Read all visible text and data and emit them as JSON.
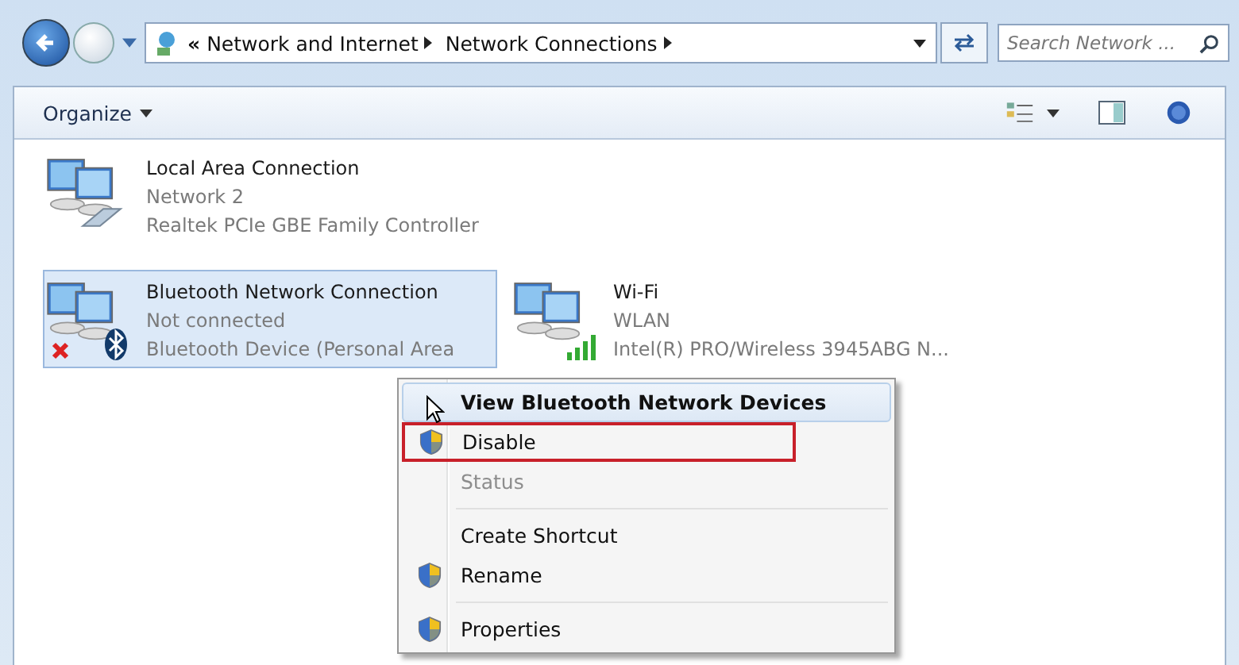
{
  "address_bar": {
    "overflow": "«",
    "breadcrumbs": [
      "Network and Internet",
      "Network Connections"
    ]
  },
  "search": {
    "placeholder": "Search Network ..."
  },
  "toolbar": {
    "organize": "Organize"
  },
  "connections": [
    {
      "name": "Local Area Connection",
      "status": "Network  2",
      "device": "Realtek PCIe GBE Family Controller",
      "kind": "wired",
      "selected": false
    },
    {
      "name": "Bluetooth Network Connection",
      "status": "Not connected",
      "device": "Bluetooth Device (Personal Area",
      "kind": "bluetooth",
      "selected": true
    },
    {
      "name": "Wi-Fi",
      "status": "WLAN",
      "device": "Intel(R) PRO/Wireless 3945ABG N...",
      "kind": "wifi",
      "selected": false
    }
  ],
  "context_menu": [
    {
      "label": "View Bluetooth Network Devices",
      "kind": "item",
      "default": true,
      "hovered": true,
      "shield": false,
      "disabled": false,
      "highlighted": false
    },
    {
      "label": "Disable",
      "kind": "item",
      "default": false,
      "hovered": false,
      "shield": true,
      "disabled": false,
      "highlighted": true
    },
    {
      "label": "Status",
      "kind": "item",
      "default": false,
      "hovered": false,
      "shield": false,
      "disabled": true,
      "highlighted": false
    },
    {
      "kind": "separator"
    },
    {
      "label": "Create Shortcut",
      "kind": "item",
      "default": false,
      "hovered": false,
      "shield": false,
      "disabled": false,
      "highlighted": false
    },
    {
      "label": "Rename",
      "kind": "item",
      "default": false,
      "hovered": false,
      "shield": true,
      "disabled": false,
      "highlighted": false
    },
    {
      "kind": "separator"
    },
    {
      "label": "Properties",
      "kind": "item",
      "default": false,
      "hovered": false,
      "shield": true,
      "disabled": false,
      "highlighted": false
    }
  ]
}
